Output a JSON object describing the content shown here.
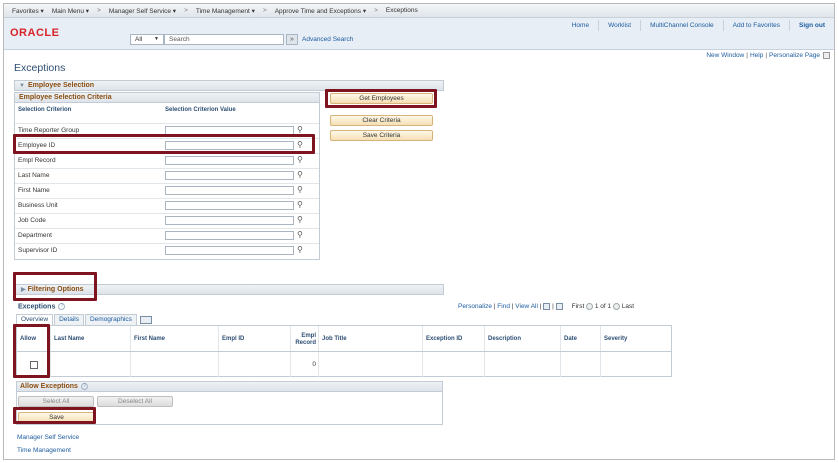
{
  "topnav": {
    "items": [
      "Favorites ▾",
      "Main Menu ▾",
      "Manager Self Service ▾",
      "Time Management ▾",
      "Approve Time and Exceptions ▾",
      "Exceptions"
    ],
    "separator": ">"
  },
  "header": {
    "logo": "ORACLE",
    "search_scope": "All",
    "search_placeholder": "Search",
    "search_go": "»",
    "advanced_search": "Advanced Search",
    "links": [
      "Home",
      "Worklist",
      "MultiChannel Console",
      "Add to Favorites",
      "Sign out"
    ]
  },
  "page_links": [
    "New Window",
    "Help",
    "Personalize Page"
  ],
  "page_title": "Exceptions",
  "employee_selection": {
    "header": "Employee Selection",
    "criteria_title": "Employee Selection Criteria",
    "col_criterion": "Selection Criterion",
    "col_value": "Selection Criterion Value",
    "rows": [
      "Time Reporter Group",
      "Employee ID",
      "Empl Record",
      "Last Name",
      "First Name",
      "Business Unit",
      "Job Code",
      "Department",
      "Supervisor ID"
    ],
    "buttons": {
      "get": "Get Employees",
      "clear": "Clear Criteria",
      "save": "Save Criteria"
    }
  },
  "filtering_options": "Filtering Options",
  "exceptions": {
    "title": "Exceptions",
    "nav": {
      "personalize": "Personalize",
      "find": "Find",
      "view_all": "View All",
      "first": "First",
      "count": "1 of 1",
      "last": "Last"
    },
    "tabs": [
      "Overview",
      "Details",
      "Demographics"
    ],
    "columns": [
      "Allow",
      "Last Name",
      "First Name",
      "Empl ID",
      "Empl Record",
      "Job Title",
      "Exception ID",
      "Description",
      "Date",
      "Severity"
    ],
    "row": {
      "empl_record": "0"
    }
  },
  "allow_exceptions": {
    "title": "Allow Exceptions",
    "select_all": "Select All",
    "deselect_all": "Deselect All",
    "save": "Save"
  },
  "footer_links": [
    "Manager Self Service",
    "Time Management"
  ],
  "colors": {
    "highlight": "#7d1420",
    "brand": "#d8242a",
    "link": "#1c5b9f"
  }
}
